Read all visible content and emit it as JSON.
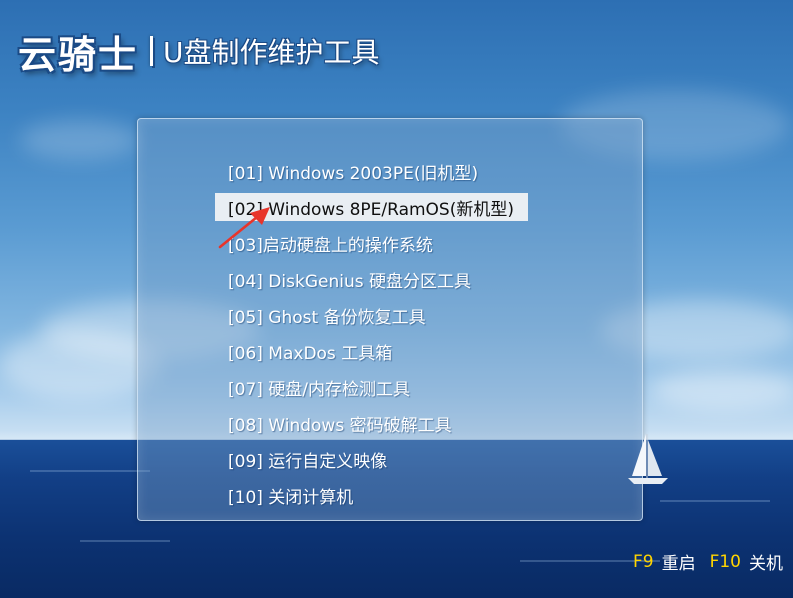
{
  "header": {
    "brand": "云骑士",
    "subtitle": "U盘制作维护工具"
  },
  "menu": {
    "selected_index": 1,
    "items": [
      {
        "label": "[01] Windows 2003PE(旧机型)"
      },
      {
        "label": "[02] Windows 8PE/RamOS(新机型)"
      },
      {
        "label": "[03]启动硬盘上的操作系统"
      },
      {
        "label": "[04] DiskGenius 硬盘分区工具"
      },
      {
        "label": "[05] Ghost 备份恢复工具"
      },
      {
        "label": "[06] MaxDos 工具箱"
      },
      {
        "label": "[07] 硬盘/内存检测工具"
      },
      {
        "label": "[08] Windows 密码破解工具"
      },
      {
        "label": "[09] 运行自定义映像"
      },
      {
        "label": "[10] 关闭计算机"
      }
    ]
  },
  "footer": {
    "keys": [
      {
        "key": "F9",
        "action": "重启"
      },
      {
        "key": "F10",
        "action": "关机"
      }
    ]
  },
  "colors": {
    "hotkey": "#ffd400",
    "selection_background": "#e9eef3",
    "arrow": "#e8352b"
  }
}
